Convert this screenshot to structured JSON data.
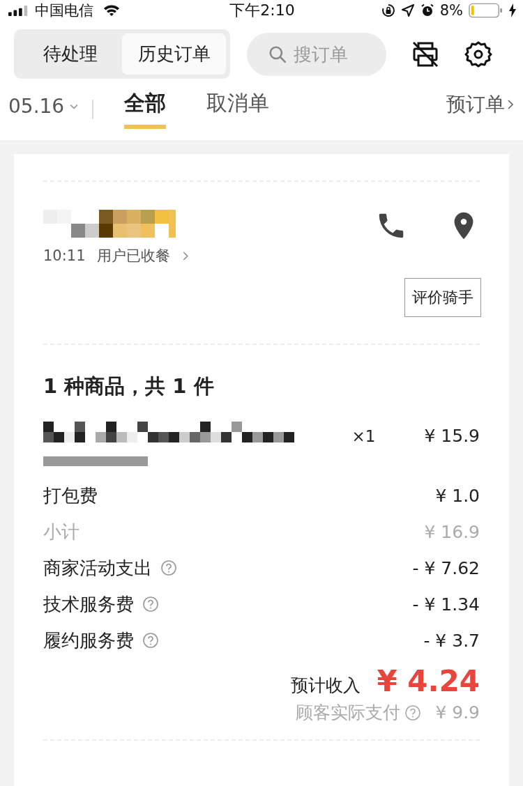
{
  "status_bar": {
    "carrier": "中国电信",
    "time": "下午2:10",
    "battery": "8%"
  },
  "segments": [
    {
      "label": "待处理",
      "selected": false
    },
    {
      "label": "历史订单",
      "selected": true
    }
  ],
  "search": {
    "placeholder": "搜订单"
  },
  "filter": {
    "date": "05.16",
    "tabs": [
      {
        "label": "全部",
        "selected": true
      },
      {
        "label": "取消单",
        "selected": false
      }
    ],
    "preorder": "预订单"
  },
  "order": {
    "status_time": "10:11",
    "status": "用户已收餐",
    "rate_button": "评价骑手",
    "summary": "1 种商品，共 1 件",
    "item": {
      "qty": "×1",
      "price": "¥ 15.9"
    },
    "fees": [
      {
        "label": "打包费",
        "amount": "¥ 1.0",
        "muted": false,
        "help": false
      },
      {
        "label": "小计",
        "amount": "¥ 16.9",
        "muted": true,
        "help": false
      },
      {
        "label": "商家活动支出",
        "amount": "- ¥ 7.62",
        "muted": false,
        "help": true
      },
      {
        "label": "技术服务费",
        "amount": "- ¥ 1.34",
        "muted": false,
        "help": true
      },
      {
        "label": "履约服务费",
        "amount": "- ¥ 3.7",
        "muted": false,
        "help": true
      }
    ],
    "income_label": "预计收入",
    "income": "¥ 4.24",
    "paid_label": "顾客实际支付",
    "paid": "¥ 9.9"
  }
}
